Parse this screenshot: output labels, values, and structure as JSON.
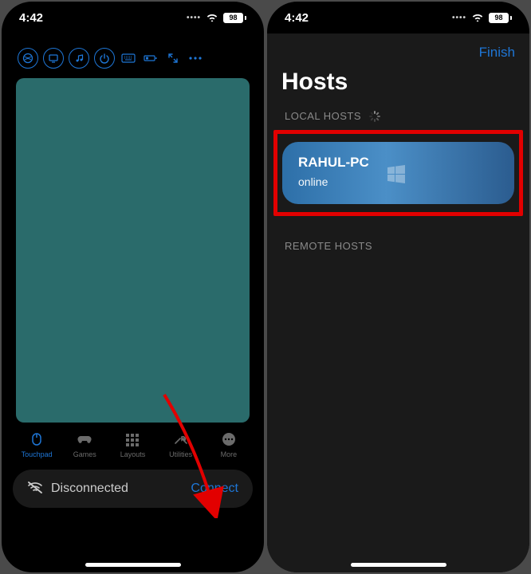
{
  "status": {
    "time": "4:42",
    "battery": "98"
  },
  "left": {
    "touchpad_label": "Touchpad",
    "tabs": {
      "touchpad": "Touchpad",
      "games": "Games",
      "layouts": "Layouts",
      "utilities": "Utilities",
      "more": "More"
    },
    "connection": {
      "status": "Disconnected",
      "action": "Connect"
    }
  },
  "right": {
    "finish": "Finish",
    "title": "Hosts",
    "local_section": "LOCAL HOSTS",
    "remote_section": "REMOTE HOSTS",
    "host": {
      "name": "RAHUL-PC",
      "status": "online"
    }
  }
}
